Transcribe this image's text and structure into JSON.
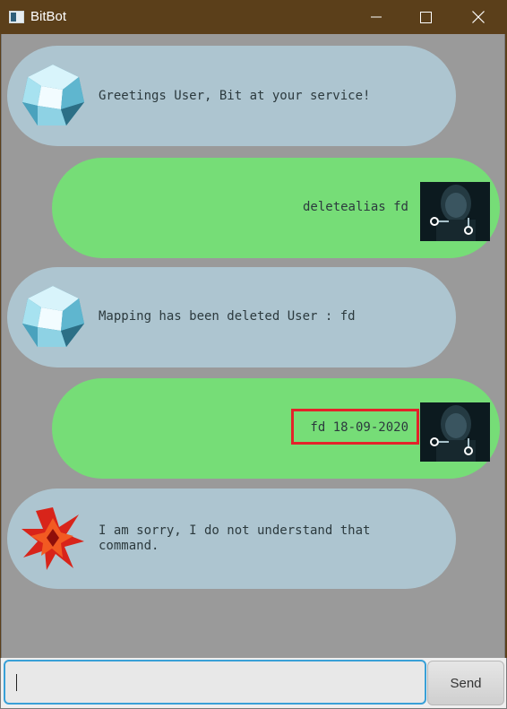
{
  "window": {
    "title": "BitBot",
    "app_icon": "window-app-icon",
    "controls": {
      "minimize": "minimize-icon",
      "maximize": "maximize-icon",
      "close": "close-icon"
    }
  },
  "colors": {
    "titlebar": "#5b3f1a",
    "chat_background": "#9a9a9a",
    "bot_bubble": "#adc5d0",
    "user_bubble": "#76dd77",
    "highlight": "#e3232a",
    "input_focus": "#39a0d7"
  },
  "messages": [
    {
      "sender": "bot",
      "avatar": "crystal-bot-avatar-icon",
      "text": "Greetings User, Bit at your service!"
    },
    {
      "sender": "user",
      "avatar": "user-photo-avatar",
      "text": "deletealias fd"
    },
    {
      "sender": "bot",
      "avatar": "crystal-bot-avatar-icon",
      "text": "Mapping has been deleted User : fd"
    },
    {
      "sender": "user",
      "avatar": "user-photo-avatar",
      "text": "fd 18-09-2020",
      "highlighted": true
    },
    {
      "sender": "bot",
      "avatar": "error-starburst-avatar-icon",
      "text": "I am sorry, I do not understand that\ncommand."
    }
  ],
  "input": {
    "value": "",
    "placeholder": ""
  },
  "send_button": {
    "label": "Send"
  }
}
